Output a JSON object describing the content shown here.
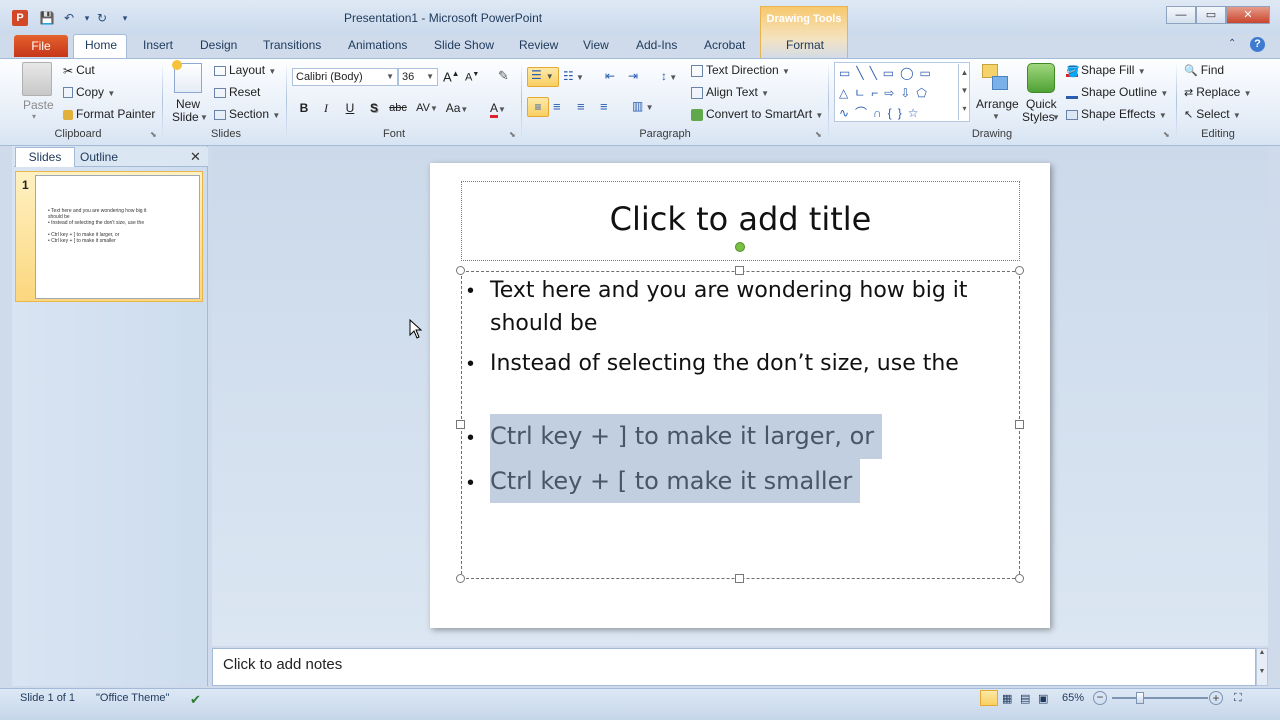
{
  "window": {
    "title": "Presentation1  -  Microsoft PowerPoint",
    "contextual_tab": "Drawing Tools",
    "app_icon": "P",
    "controls": {
      "minimize": "—",
      "maximize": "▭",
      "close": "✕"
    }
  },
  "quick_access": {
    "save": "💾",
    "undo": "↶",
    "redo": "↻",
    "customize": "▾"
  },
  "tabs": [
    "File",
    "Home",
    "Insert",
    "Design",
    "Transitions",
    "Animations",
    "Slide Show",
    "Review",
    "View",
    "Add-Ins",
    "Acrobat",
    "Format"
  ],
  "ribbon": {
    "clipboard": {
      "label": "Clipboard",
      "paste": "Paste",
      "cut": "Cut",
      "copy": "Copy",
      "format_painter": "Format Painter"
    },
    "slides": {
      "label": "Slides",
      "new_slide_1": "New",
      "new_slide_2": "Slide",
      "layout": "Layout",
      "reset": "Reset",
      "section": "Section"
    },
    "font": {
      "label": "Font",
      "font_name": "Calibri (Body)",
      "font_size": "36",
      "bold": "B",
      "italic": "I",
      "underline": "U",
      "shadow": "S",
      "strike": "abc",
      "spacing": "AV",
      "case": "Aa",
      "color": "A",
      "grow": "A",
      "shrink": "A"
    },
    "paragraph": {
      "label": "Paragraph",
      "text_direction": "Text Direction",
      "align_text": "Align Text",
      "convert_smartart": "Convert to SmartArt"
    },
    "drawing": {
      "label": "Drawing",
      "arrange": "Arrange",
      "quick_styles_1": "Quick",
      "quick_styles_2": "Styles",
      "shape_fill": "Shape Fill",
      "shape_outline": "Shape Outline",
      "shape_effects": "Shape Effects"
    },
    "editing": {
      "label": "Editing",
      "find": "Find",
      "replace": "Replace",
      "select": "Select"
    }
  },
  "slide_pane": {
    "tab_slides": "Slides",
    "tab_outline": "Outline",
    "close": "✕",
    "slide_number": "1",
    "thumb_lines": [
      "• Text here and you are wondering how big it",
      "   should be",
      "• Instead of selecting the don't size, use the",
      "• Ctrl key + ] to make it larger, or",
      "• Ctrl key + [ to make it smaller"
    ]
  },
  "slide": {
    "title_placeholder": "Click to add title",
    "bullets": [
      "Text here and you are wondering how big it",
      "should be",
      "Instead of selecting the don’t size, use the",
      "Ctrl key + ] to make it larger, or",
      "Ctrl key + [ to make it smaller"
    ],
    "bullet_char": "•"
  },
  "notes": {
    "placeholder": "Click to add notes"
  },
  "status": {
    "slide": "Slide 1 of 1",
    "theme": "\"Office Theme\"",
    "zoom": "65%",
    "zoom_level_percent": 65
  },
  "colors": {
    "file_tab": "#c5361a",
    "accent": "#1e395b",
    "selection": "#c2cfe0",
    "contextual": "#f7c86e"
  }
}
